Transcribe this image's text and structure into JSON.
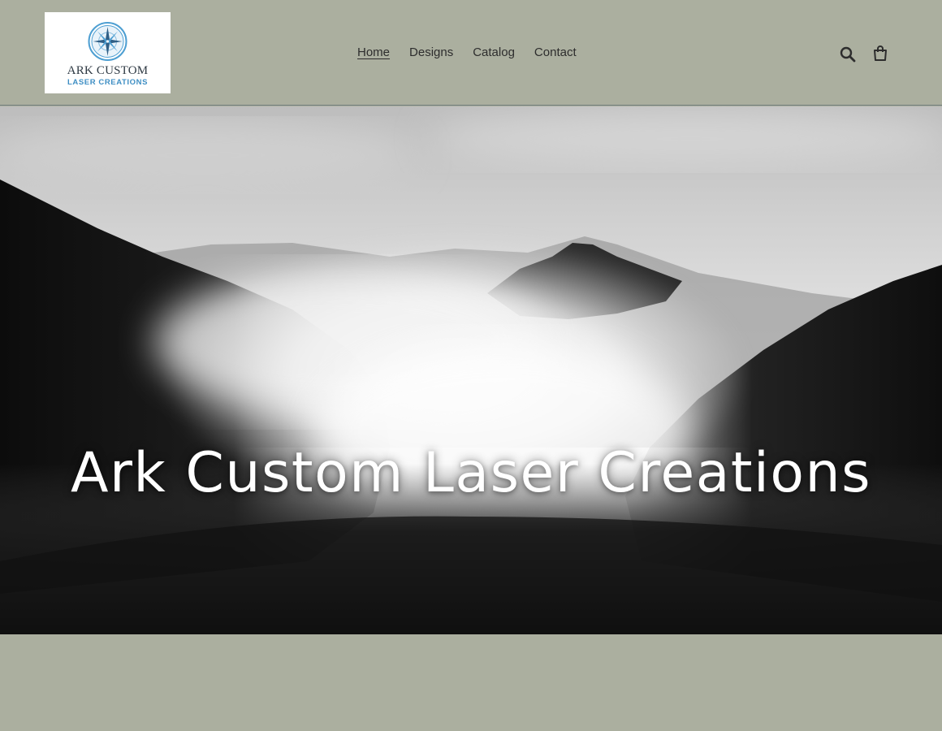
{
  "logo": {
    "line1": "ARK CUSTOM",
    "line2": "LASER CREATIONS",
    "icon": "compass-rose-icon",
    "accent_color": "#3f8fc4"
  },
  "nav": {
    "items": [
      {
        "label": "Home",
        "active": true
      },
      {
        "label": "Designs",
        "active": false
      },
      {
        "label": "Catalog",
        "active": false
      },
      {
        "label": "Contact",
        "active": false
      }
    ]
  },
  "header_icons": {
    "search": "search-icon",
    "cart": "cart-icon"
  },
  "hero": {
    "title": "Ark Custom Laser Creations",
    "image": "misty-mountain-forest-bw"
  },
  "colors": {
    "background": "#abaf9f",
    "header_border": "#6f7c7c",
    "hero_text": "#ffffff"
  }
}
